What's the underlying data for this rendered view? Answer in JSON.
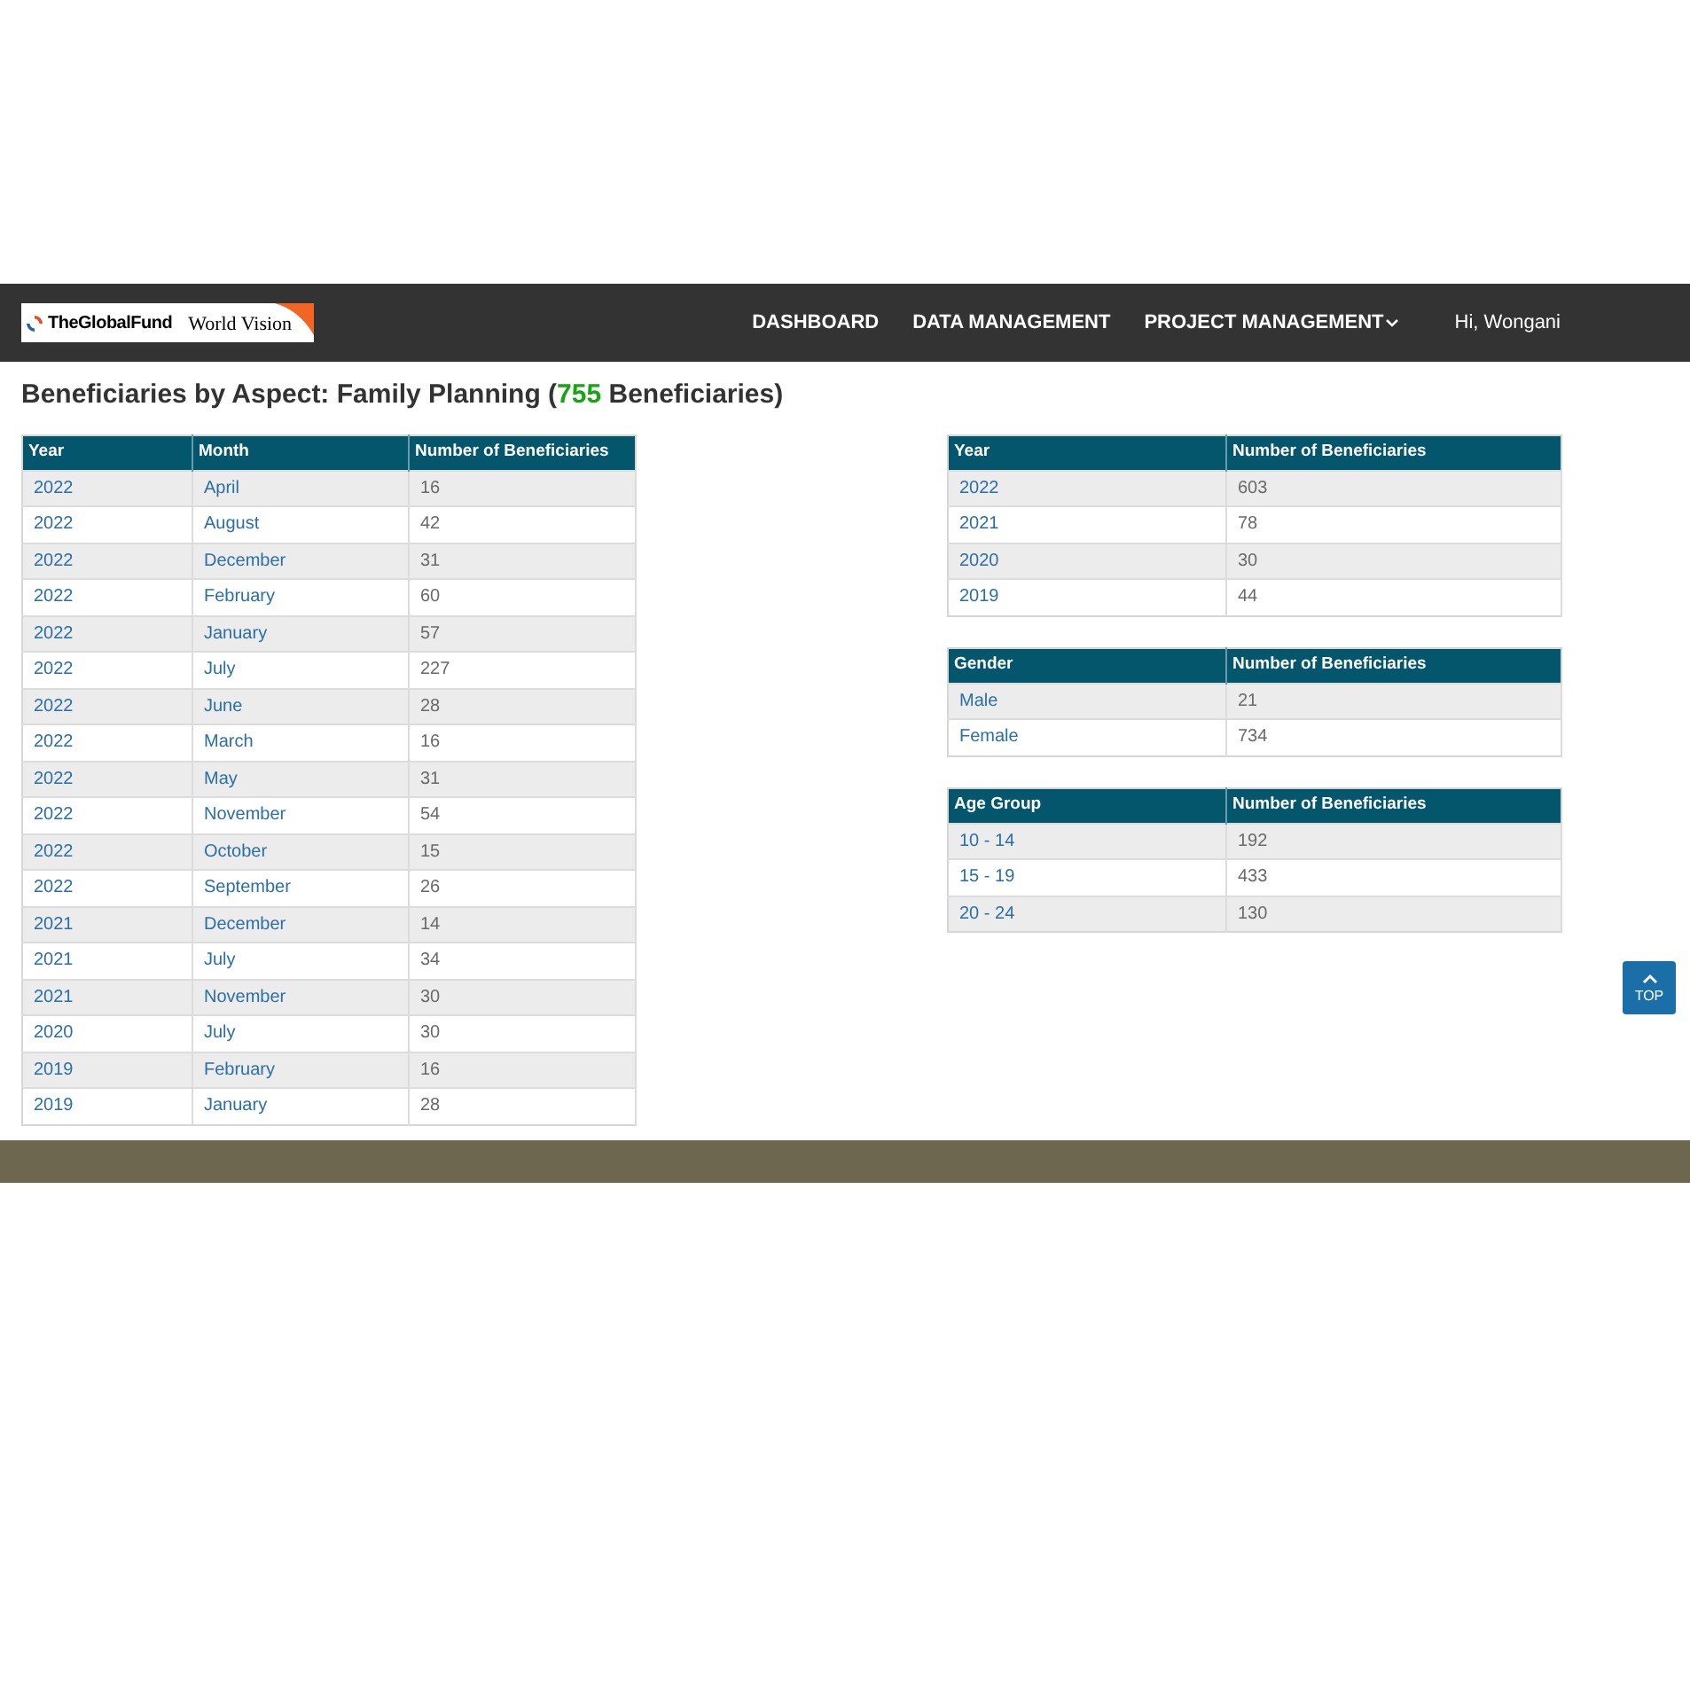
{
  "navbar": {
    "logo": {
      "left": "TheGlobalFund",
      "right": "World Vision"
    },
    "links": [
      {
        "label": "DASHBOARD",
        "dropdown": false
      },
      {
        "label": "DATA MANAGEMENT",
        "dropdown": false
      },
      {
        "label": "PROJECT MANAGEMENT",
        "dropdown": true
      }
    ],
    "user": "Hi, Wongani"
  },
  "heading": {
    "before": "Beneficiaries by Aspect: Family Planning (",
    "count": "755",
    "after": " Beneficiaries)"
  },
  "monthly_table": {
    "columns": [
      "Year",
      "Month",
      "Number of Beneficiaries"
    ],
    "rows": [
      [
        "2022",
        "April",
        "16"
      ],
      [
        "2022",
        "August",
        "42"
      ],
      [
        "2022",
        "December",
        "31"
      ],
      [
        "2022",
        "February",
        "60"
      ],
      [
        "2022",
        "January",
        "57"
      ],
      [
        "2022",
        "July",
        "227"
      ],
      [
        "2022",
        "June",
        "28"
      ],
      [
        "2022",
        "March",
        "16"
      ],
      [
        "2022",
        "May",
        "31"
      ],
      [
        "2022",
        "November",
        "54"
      ],
      [
        "2022",
        "October",
        "15"
      ],
      [
        "2022",
        "September",
        "26"
      ],
      [
        "2021",
        "December",
        "14"
      ],
      [
        "2021",
        "July",
        "34"
      ],
      [
        "2021",
        "November",
        "30"
      ],
      [
        "2020",
        "July",
        "30"
      ],
      [
        "2019",
        "February",
        "16"
      ],
      [
        "2019",
        "January",
        "28"
      ]
    ]
  },
  "side_tables": [
    {
      "columns": [
        "Year",
        "Number of Beneficiaries"
      ],
      "rows": [
        [
          "2022",
          "603"
        ],
        [
          "2021",
          "78"
        ],
        [
          "2020",
          "30"
        ],
        [
          "2019",
          "44"
        ]
      ]
    },
    {
      "columns": [
        "Gender",
        "Number of Beneficiaries"
      ],
      "rows": [
        [
          "Male",
          "21"
        ],
        [
          "Female",
          "734"
        ]
      ]
    },
    {
      "columns": [
        "Age Group",
        "Number of Beneficiaries"
      ],
      "rows": [
        [
          "10 - 14",
          "192"
        ],
        [
          "15 - 19",
          "433"
        ],
        [
          "20 - 24",
          "130"
        ]
      ]
    }
  ],
  "top_button": "TOP"
}
